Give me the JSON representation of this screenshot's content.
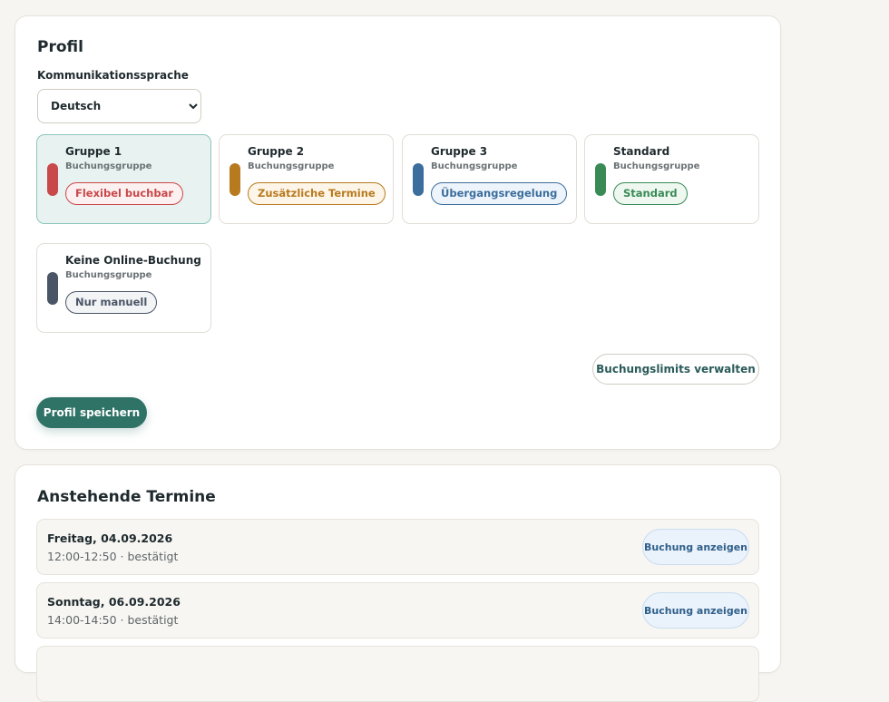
{
  "profile": {
    "title": "Profil",
    "language_label": "Kommunikationssprache",
    "language_value": "Deutsch",
    "groups": [
      {
        "name": "Gruppe 1",
        "subtitle": "Buchungsgruppe",
        "badge": "Flexibel buchbar",
        "color": "#c9484a",
        "badge_bg": "#fdf0f0",
        "badge_fg": "#c9484a",
        "selected": true
      },
      {
        "name": "Gruppe 2",
        "subtitle": "Buchungsgruppe",
        "badge": "Zusätzliche Termine",
        "color": "#b87a1e",
        "badge_bg": "#fdf5e8",
        "badge_fg": "#b87a1e",
        "selected": false
      },
      {
        "name": "Gruppe 3",
        "subtitle": "Buchungsgruppe",
        "badge": "Übergangsregelung",
        "color": "#3b6e9c",
        "badge_bg": "#eef4fb",
        "badge_fg": "#3b6e9c",
        "selected": false
      },
      {
        "name": "Standard",
        "subtitle": "Buchungsgruppe",
        "badge": "Standard",
        "color": "#3a8a55",
        "badge_bg": "#eef8f1",
        "badge_fg": "#3a8a55",
        "selected": false
      },
      {
        "name": "Keine Online-Buchung",
        "subtitle": "Buchungsgruppe",
        "badge": "Nur manuell",
        "color": "#4a5566",
        "badge_bg": "#f3f4f6",
        "badge_fg": "#4a5566",
        "selected": false
      }
    ],
    "limits_button": "Buchungslimits verwalten",
    "save_button": "Profil speichern"
  },
  "appointments": {
    "title": "Anstehende Termine",
    "items": [
      {
        "date": "Freitag, 04.09.2026",
        "time": "12:00-12:50 · bestätigt",
        "button": "Buchung anzeigen"
      },
      {
        "date": "Sonntag, 06.09.2026",
        "time": "14:00-14:50 · bestätigt",
        "button": "Buchung anzeigen"
      }
    ]
  }
}
